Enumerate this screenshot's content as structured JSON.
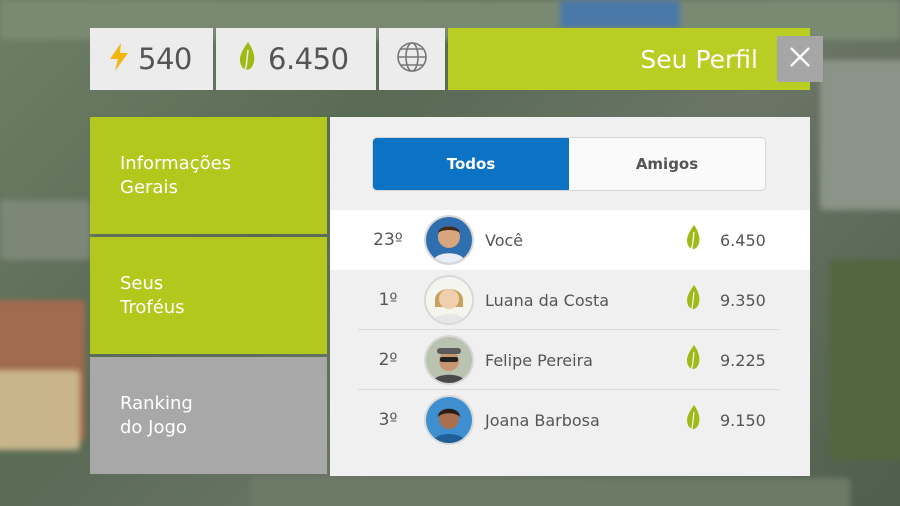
{
  "topbar": {
    "energy_value": "540",
    "points_value": "6.450",
    "title": "Seu Perfil"
  },
  "side_menu": [
    {
      "label": "Informações\nGerais"
    },
    {
      "label": "Seus\nTroféus"
    },
    {
      "label": "Ranking\ndo Jogo"
    }
  ],
  "tabs": [
    {
      "label": "Todos"
    },
    {
      "label": "Amigos"
    }
  ],
  "ranking": [
    {
      "rank": "23º",
      "name": "Você",
      "score": "6.450"
    },
    {
      "rank": "1º",
      "name": "Luana da Costa",
      "score": "9.350"
    },
    {
      "rank": "2º",
      "name": "Felipe Pereira",
      "score": "9.225"
    },
    {
      "rank": "3º",
      "name": "Joana Barbosa",
      "score": "9.150"
    }
  ],
  "colors": {
    "accent_green": "#b9cd22",
    "tab_blue": "#0c72c4",
    "bolt": "#f2b70f"
  },
  "icons": [
    "lightning-icon",
    "leaf-icon",
    "globe-icon",
    "close-icon"
  ]
}
